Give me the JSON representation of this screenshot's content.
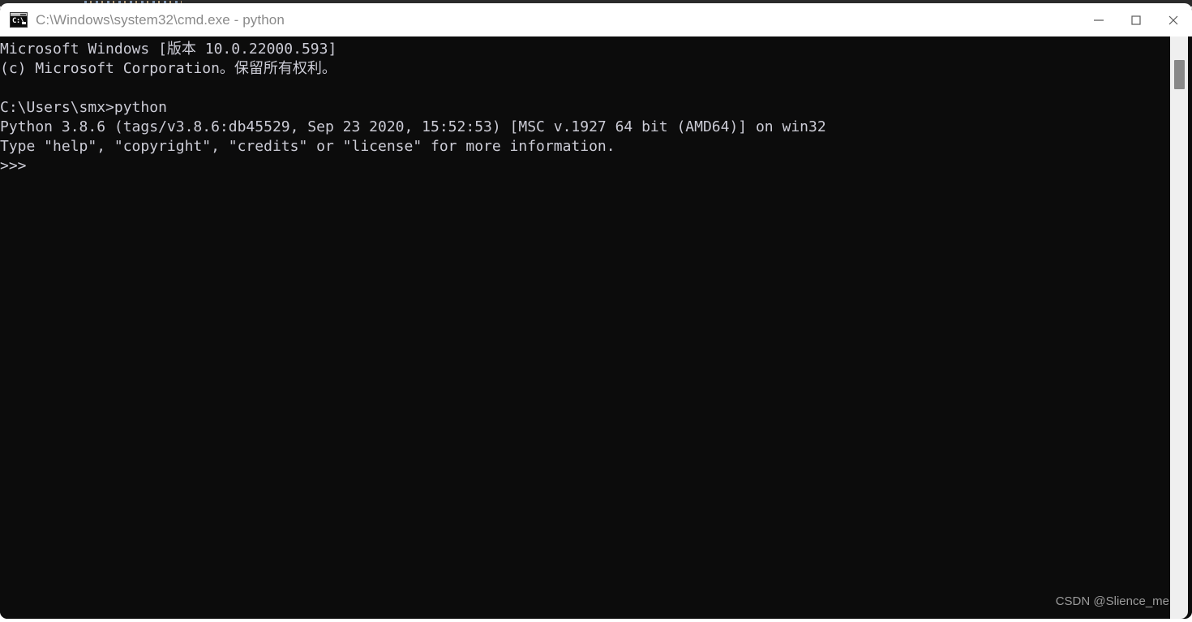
{
  "window": {
    "title": "C:\\Windows\\system32\\cmd.exe - python",
    "icon": "cmd-console-icon",
    "icon_glyph": "C:\\",
    "controls": {
      "minimize_label": "Minimize",
      "maximize_label": "Maximize",
      "close_label": "Close"
    },
    "colors": {
      "titlebar_bg": "#ffffff",
      "title_text": "#8a8a8a",
      "console_bg": "#0c0c0c",
      "console_text": "#ccccd6",
      "scrollbar_track": "#efefef",
      "scrollbar_thumb": "#888888",
      "page_bg": "#ffffff",
      "background_strip": "#2b2b2b"
    }
  },
  "console": {
    "lines": [
      "Microsoft Windows [版本 10.0.22000.593]",
      "(c) Microsoft Corporation。保留所有权利。",
      "",
      "C:\\Users\\smx>python",
      "Python 3.8.6 (tags/v3.8.6:db45529, Sep 23 2020, 15:52:53) [MSC v.1927 64 bit (AMD64)] on win32",
      "Type \"help\", \"copyright\", \"credits\" or \"license\" for more information.",
      ">>>"
    ],
    "prompt": ">>>",
    "shell_prompt": "C:\\Users\\smx>",
    "command_entered": "python",
    "os_banner": "Microsoft Windows [版本 10.0.22000.593]",
    "copyright": "(c) Microsoft Corporation。保留所有权利。",
    "python_version": "3.8.6",
    "python_build": "tags/v3.8.6:db45529",
    "python_build_date": "Sep 23 2020, 15:52:53",
    "python_compiler": "MSC v.1927 64 bit (AMD64)",
    "python_platform": "win32"
  },
  "scrollbar": {
    "thumb_top_pct": 4,
    "thumb_height_pct": 5
  },
  "watermark": {
    "text": "CSDN @Slience_me"
  }
}
